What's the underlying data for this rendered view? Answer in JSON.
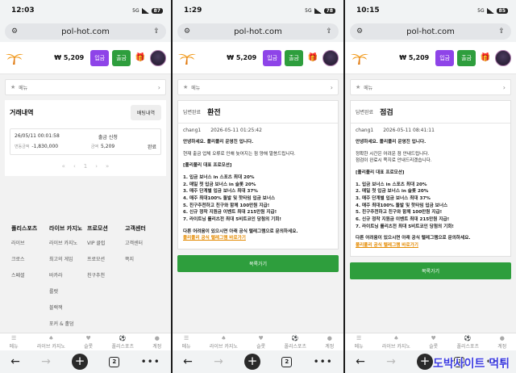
{
  "browser": {
    "url": "pol-hot.com",
    "tab_count": "2"
  },
  "site": {
    "balance": "₩ 5,209",
    "deposit_label": "입금",
    "withdraw_label": "출금",
    "menu_label": "메뉴"
  },
  "panels": [
    {
      "time": "12:03",
      "battery": "87",
      "network": "5G"
    },
    {
      "time": "1:29",
      "battery": "78",
      "network": "5G"
    },
    {
      "time": "10:15",
      "battery": "85",
      "network": "5G"
    }
  ],
  "history": {
    "title": "거래내역",
    "button": "배팅내역",
    "row": {
      "datetime": "26/05/11 00:01:58",
      "type": "출금 신청",
      "change_label": "변동금액",
      "change_value": "-1,830,000",
      "amount_label": "금액",
      "amount_value": "5,209",
      "status": "완료"
    },
    "pager": [
      "«",
      "‹",
      "1",
      "›",
      "»"
    ]
  },
  "footer": {
    "columns": [
      {
        "heading": "폴리스포츠",
        "items": [
          "라이브",
          "크로스",
          "스페셜"
        ]
      },
      {
        "heading": "라이브 카지노",
        "items": [
          "라이브 카지노",
          "최고의 게임",
          "바카라",
          "룰렛",
          "블랙잭",
          "포커 & 홀덤"
        ]
      },
      {
        "heading": "프로모션",
        "items": [
          "VIP 클럽",
          "프로모션",
          "친구추천"
        ]
      },
      {
        "heading": "고객센터",
        "items": [
          "고객센터",
          "쪽지"
        ]
      }
    ]
  },
  "bottom_nav": [
    {
      "label": "메뉴",
      "icon": "menu-icon"
    },
    {
      "label": "라이브 카지노",
      "icon": "casino-icon"
    },
    {
      "label": "슬롯",
      "icon": "slot-icon"
    },
    {
      "label": "폴리스포츠",
      "icon": "sports-icon"
    },
    {
      "label": "계정",
      "icon": "account-icon"
    }
  ],
  "notices": [
    {
      "badge": "답변완료",
      "title": "환전",
      "author": "chang1",
      "datetime": "2026-05-11 01:25:42",
      "greeting": "안녕하세요. 폴리폴리 운영진 입니다.",
      "message": "현재 출금 업체 오류로 인해 늦어지는 점 양해 말씀드립니다.",
      "promo_title": "[폴리폴리 대표 프로모션]",
      "promos": [
        "1. 입금 보너스 in 스포츠 최대 20%",
        "2. 매일 첫 입금 보너스 in 슬롯 20%",
        "3. 매주 단계별 입금 보너스 최대 37%",
        "4. 매주 최대100% 돌발 및 핫타임 입금 보너스",
        "5. 친구추천하고 친구와 함께 100만원 지급!",
        "6. 신규 정착 지원금 이벤트 최대 215만원 지급!",
        "7. 라이트닝 롤리츠전 최대 5비트코인 당첨의 기회!"
      ],
      "closing": "다른 어려움이 있으시면 아래 공식 텔레그램으로 문의하세요.",
      "link": "폴리폴리 공식 텔레그램 바로가기",
      "list_button": "목록가기"
    },
    {
      "badge": "답변완료",
      "title": "점검",
      "author": "chang1",
      "datetime": "2026-05-11 08:41:11",
      "greeting": "안녕하세요. 폴리폴리 운영진 입니다.",
      "message": "정확한 시간은 어려운 점 안내드립니다.",
      "message2": "점검이 완료시 쪽지로 안내드리겠습니다.",
      "promo_title": "[폴리폴리 대표 프로모션]",
      "promos": [
        "1. 입금 보너스 in 스포츠 최대 20%",
        "2. 매일 첫 입금 보너스 in 슬롯 20%",
        "3. 매주 단계별 입금 보너스 최대 37%",
        "4. 매주 최대100% 돌발 및 핫타임 입금 보너스",
        "5. 친구추천하고 친구와 함께 100만원 지급!",
        "6. 신규 정착 지원금 이벤트 최대 215만원 지급!",
        "7. 라이트닝 롤리츠전 최대 5비트코인 당첨의 기회!"
      ],
      "closing": "다른 어려움이 있으시면 아래 공식 텔레그램으로 문의하세요.",
      "link": "폴리폴리 공식 텔레그램 바로가기",
      "list_button": "목록가기"
    }
  ],
  "watermark": "도박사이트 먹튀"
}
